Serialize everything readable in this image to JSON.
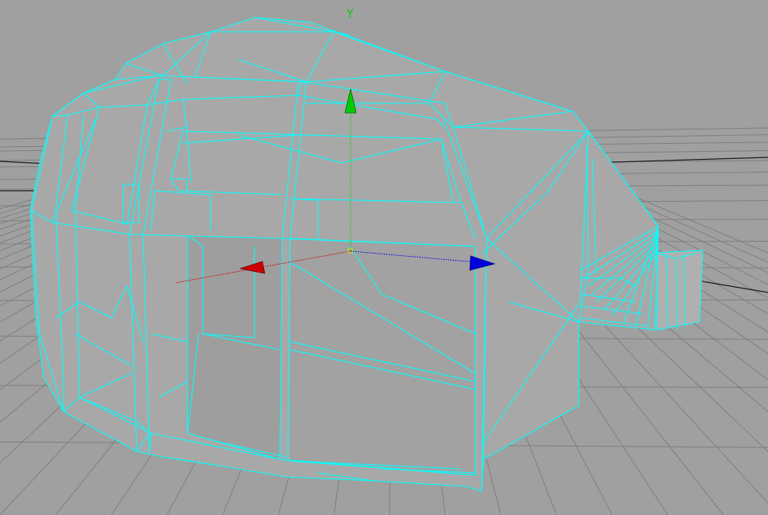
{
  "viewport": {
    "background_color": "#a0a0a0",
    "grid_color": "#7f7f7f",
    "horizon_color": "#111111"
  },
  "mesh": {
    "fill_color": "#a5a5a5",
    "wire_color": "#00ffff"
  },
  "manipulator": {
    "y_label": "Y",
    "x_color": "#cc0000",
    "y_color": "#00cc00",
    "z_color": "#0000ee",
    "center_color": "#ffff00"
  }
}
